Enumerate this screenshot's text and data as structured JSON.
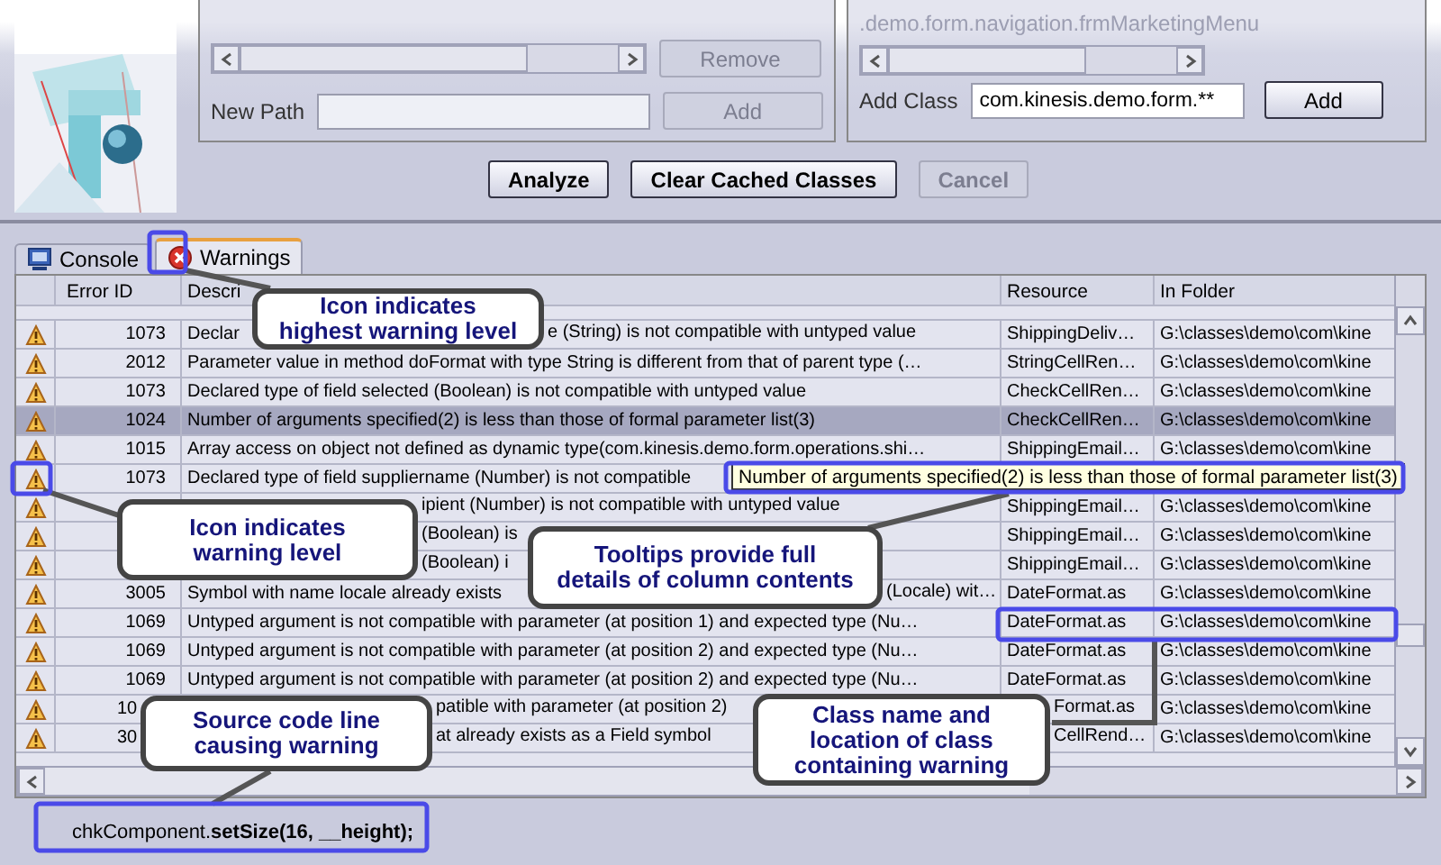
{
  "path_group": {
    "remove_button": {
      "label": "Remove",
      "disabled": true
    },
    "new_path_label": "New Path",
    "add_button": {
      "label": "Add",
      "disabled": true
    }
  },
  "class_group": {
    "list_item": ".demo.form.navigation.frmMarketingMenu",
    "add_class_label": "Add Class",
    "add_class_value": "com.kinesis.demo.form.**",
    "add_button": {
      "label": "Add",
      "disabled": false
    }
  },
  "actions": [
    {
      "label": "Analyze",
      "disabled": false
    },
    {
      "label": "Clear Cached Classes",
      "disabled": false
    },
    {
      "label": "Cancel",
      "disabled": true
    }
  ],
  "tabs": [
    {
      "label": "Console",
      "kind": "console",
      "selected": false
    },
    {
      "label": "Warnings",
      "kind": "warnings",
      "selected": true
    }
  ],
  "table": {
    "columns": [
      "Error ID",
      "Descri",
      "Resource",
      "In Folder"
    ],
    "rows": [
      {
        "error_id": "1073",
        "description": [
          {
            "text": "Declar",
            "kind": "lead"
          },
          {
            "text": "e (String) is not compatible with untyped value",
            "kind": "tail"
          }
        ],
        "resource": "ShippingDeliv…",
        "folder": "G:\\classes\\demo\\com\\kine",
        "selected": false
      },
      {
        "error_id": "2012",
        "description": "Parameter value in method doFormat with type String is different from that of parent type (…",
        "resource": "StringCellRen…",
        "folder": "G:\\classes\\demo\\com\\kine",
        "selected": false
      },
      {
        "error_id": "1073",
        "description": "Declared type of field selected (Boolean) is not compatible with untyped value",
        "resource": "CheckCellRen…",
        "folder": "G:\\classes\\demo\\com\\kine",
        "selected": false
      },
      {
        "error_id": "1024",
        "description": "Number of arguments specified(2) is less than those of formal parameter list(3)",
        "resource": "CheckCellRen…",
        "folder": "G:\\classes\\demo\\com\\kine",
        "selected": true
      },
      {
        "error_id": "1015",
        "description": "Array access on object not defined as dynamic type(com.kinesis.demo.form.operations.shi…",
        "resource": "ShippingEmail…",
        "folder": "G:\\classes\\demo\\com\\kine",
        "selected": false
      },
      {
        "error_id": "1073",
        "description": "Declared type of field suppliername (Number) is not compatible",
        "selected": false
      },
      {
        "description": [
          {
            "text": "ipient (Number) is not compatible with untyped value",
            "kind": "tail"
          }
        ],
        "resource": "ShippingEmail…",
        "folder": "G:\\classes\\demo\\com\\kine",
        "selected": false
      },
      {
        "description": [
          {
            "text": "(Boolean) is",
            "kind": "tail"
          }
        ],
        "resource": "ShippingEmail…",
        "folder": "G:\\classes\\demo\\com\\kine",
        "selected": false
      },
      {
        "description": [
          {
            "text": "(Boolean) i",
            "kind": "tail"
          }
        ],
        "resource": "ShippingEmail…",
        "folder": "G:\\classes\\demo\\com\\kine",
        "selected": false
      },
      {
        "error_id": "3005",
        "description": [
          {
            "text": "Symbol with name locale already exists",
            "kind": "lead"
          },
          {
            "text": "(Locale) wit…",
            "kind": "tail"
          }
        ],
        "resource": "DateFormat.as",
        "folder": "G:\\classes\\demo\\com\\kine",
        "selected": false
      },
      {
        "error_id": "1069",
        "description": "Untyped argument  is not compatible with parameter (at position 1) and expected type (Nu…",
        "resource": "DateFormat.as",
        "folder": "G:\\classes\\demo\\com\\kine",
        "selected": false
      },
      {
        "error_id": "1069",
        "description": "Untyped argument  is not compatible with parameter (at position 2) and expected type (Nu…",
        "resource": "DateFormat.as",
        "folder": "G:\\classes\\demo\\com\\kine",
        "selected": false
      },
      {
        "error_id": "1069",
        "description": "Untyped argument  is not compatible with parameter (at position 2) and expected type (Nu…",
        "resource": "DateFormat.as",
        "folder": "G:\\classes\\demo\\com\\kine",
        "selected": false
      },
      {
        "error_id": [
          {
            "text": "10",
            "kind": "lead"
          }
        ],
        "description": [
          {
            "text": "patible with parameter (at position 2)",
            "kind": "tail"
          }
        ],
        "resource": [
          {
            "text": "Format.as",
            "kind": "tail"
          }
        ],
        "folder": "G:\\classes\\demo\\com\\kine",
        "selected": false
      },
      {
        "error_id": [
          {
            "text": "30",
            "kind": "lead"
          }
        ],
        "description": [
          {
            "text": "at already exists as a Field symbol",
            "kind": "tail"
          }
        ],
        "resource": [
          {
            "text": "CellRend…",
            "kind": "tail"
          }
        ],
        "folder": "G:\\classes\\demo\\com\\kine",
        "selected": false
      }
    ]
  },
  "tooltip": "Number of arguments specified(2) is less than those of formal parameter list(3)",
  "source_line": "chkComponent.**setSize(16, __height);**",
  "callouts": [
    {
      "text": "Icon indicates\nhighest warning level"
    },
    {
      "text": "Icon indicates\nwarning level"
    },
    {
      "text": "Tooltips provide full\ndetails of column contents"
    },
    {
      "text": "Source code line\ncausing warning"
    },
    {
      "text": "Class name and\nlocation of class\ncontaining warning"
    }
  ]
}
